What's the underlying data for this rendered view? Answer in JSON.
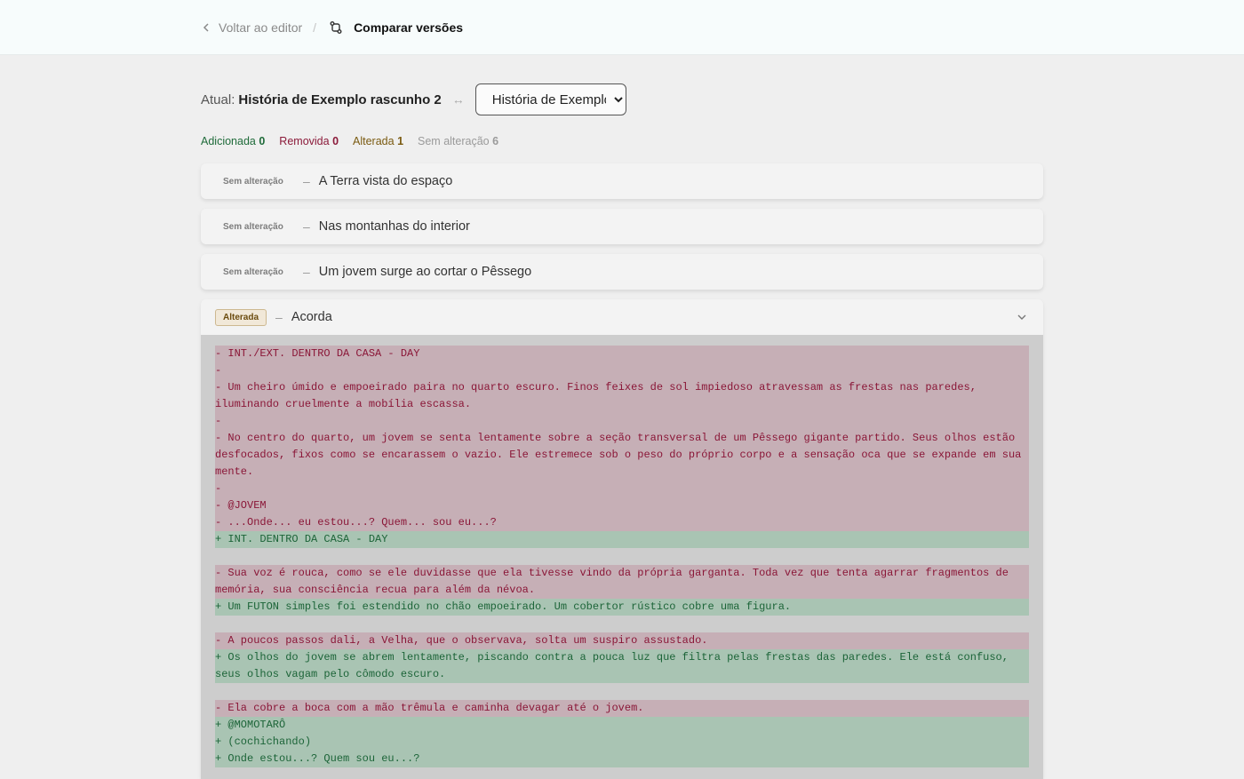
{
  "nav": {
    "back_label": "Voltar ao editor",
    "separator": "/",
    "page_title": "Comparar versões"
  },
  "compare": {
    "current_label": "Atual:",
    "current_name": "História de Exemplo rascunho 2",
    "swap_symbol": "↔",
    "selected_version": "História de Exemplo"
  },
  "stats": {
    "added_label": "Adicionada",
    "added": "0",
    "removed_label": "Removida",
    "removed": "0",
    "changed_label": "Alterada",
    "changed": "1",
    "unchanged_label": "Sem alteração",
    "unchanged": "6"
  },
  "scenes": [
    {
      "status": "Sem alteração",
      "title": "A Terra vista do espaço"
    },
    {
      "status": "Sem alteração",
      "title": "Nas montanhas do interior"
    },
    {
      "status": "Sem alteração",
      "title": "Um jovem surge ao cortar o Pêssego"
    }
  ],
  "expanded": {
    "status": "Alterada",
    "title": "Acorda",
    "diff": [
      {
        "t": "rm",
        "text": "- INT./EXT. DENTRO DA CASA - DAY"
      },
      {
        "t": "rm",
        "text": "-"
      },
      {
        "t": "rm",
        "text": "- Um cheiro úmido e empoeirado paira no quarto escuro. Finos feixes de sol impiedoso atravessam as frestas nas paredes, iluminando cruelmente a mobília escassa."
      },
      {
        "t": "rm",
        "text": "-"
      },
      {
        "t": "rm",
        "text": "- No centro do quarto, um jovem se senta lentamente sobre a seção transversal de um Pêssego gigante partido. Seus olhos estão desfocados, fixos como se encarassem o vazio. Ele estremece sob o peso do próprio corpo e a sensação oca que se expande em sua mente."
      },
      {
        "t": "rm",
        "text": "-"
      },
      {
        "t": "rm",
        "text": "- @JOVEM"
      },
      {
        "t": "rm",
        "text": "- ...Onde... eu estou...? Quem... sou eu...?"
      },
      {
        "t": "ad",
        "text": "+ INT. DENTRO DA CASA - DAY"
      },
      {
        "t": "gap",
        "text": ""
      },
      {
        "t": "rm",
        "text": "- Sua voz é rouca, como se ele duvidasse que ela tivesse vindo da própria garganta. Toda vez que tenta agarrar fragmentos de memória, sua consciência recua para além da névoa."
      },
      {
        "t": "ad",
        "text": "+ Um FUTON simples foi estendido no chão empoeirado. Um cobertor rústico cobre uma figura."
      },
      {
        "t": "gap",
        "text": ""
      },
      {
        "t": "rm",
        "text": "- A poucos passos dali, a Velha, que o observava, solta um suspiro assustado."
      },
      {
        "t": "ad",
        "text": "+ Os olhos do jovem se abrem lentamente, piscando contra a pouca luz que filtra pelas frestas das paredes. Ele está confuso, seus olhos vagam pelo cômodo escuro."
      },
      {
        "t": "gap",
        "text": ""
      },
      {
        "t": "rm",
        "text": "- Ela cobre a boca com a mão trêmula e caminha devagar até o jovem."
      },
      {
        "t": "ad",
        "text": "+ @MOMOTARÔ"
      },
      {
        "t": "ad",
        "text": "+ (cochichando)"
      },
      {
        "t": "ad",
        "text": "+ Onde estou...? Quem sou eu...?"
      }
    ]
  }
}
